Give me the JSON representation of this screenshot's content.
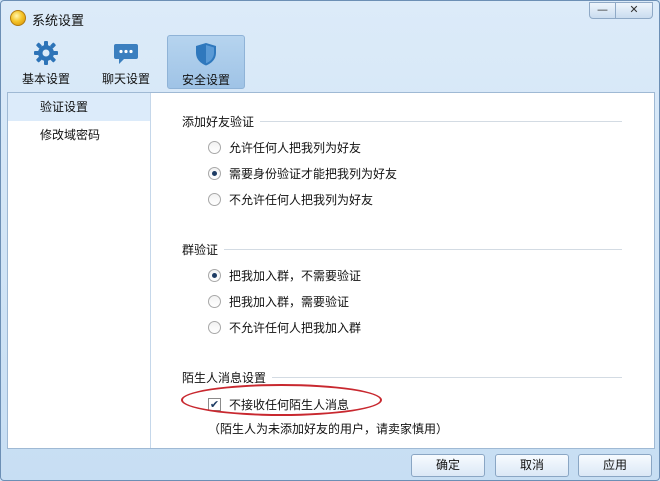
{
  "window": {
    "title": "系统设置",
    "controls": {
      "minimize": "—",
      "close": "✕"
    }
  },
  "toolbar": {
    "tabs": [
      {
        "label": "基本设置",
        "icon": "gear-icon",
        "active": false
      },
      {
        "label": "聊天设置",
        "icon": "chat-bubble-icon",
        "active": false
      },
      {
        "label": "安全设置",
        "icon": "shield-icon",
        "active": true
      }
    ]
  },
  "sidebar": {
    "items": [
      {
        "label": "验证设置",
        "active": true
      },
      {
        "label": "修改域密码",
        "active": false
      }
    ]
  },
  "friend_verify": {
    "title": "添加好友验证",
    "options": [
      {
        "label": "允许任何人把我列为好友",
        "selected": false
      },
      {
        "label": "需要身份验证才能把我列为好友",
        "selected": true
      },
      {
        "label": "不允许任何人把我列为好友",
        "selected": false
      }
    ]
  },
  "group_verify": {
    "title": "群验证",
    "options": [
      {
        "label": "把我加入群，不需要验证",
        "selected": true
      },
      {
        "label": "把我加入群，需要验证",
        "selected": false
      },
      {
        "label": "不允许任何人把我加入群",
        "selected": false
      }
    ]
  },
  "stranger": {
    "title": "陌生人消息设置",
    "checkbox_label": "不接收任何陌生人消息",
    "checked": true,
    "note": "（陌生人为未添加好友的用户，请卖家慎用）"
  },
  "footer": {
    "ok": "确定",
    "cancel": "取消",
    "apply": "应用"
  },
  "colors": {
    "accent": "#1d3b63",
    "highlight_ellipse": "#c8282f"
  }
}
